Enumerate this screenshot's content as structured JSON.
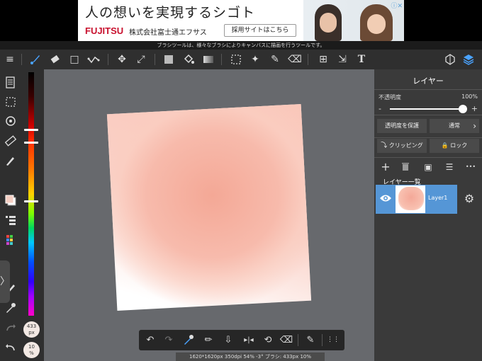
{
  "ad": {
    "headline": "人の想いを実現するシゴト",
    "brand": "FUJITSU",
    "company": "株式会社富士通エフサス",
    "button_label": "採用サイトはこちら",
    "ad_marker": "ⓘ✕"
  },
  "tooltip": "ブラシツールは、様々なブラシによりキャンバスに描画を行うツールです。",
  "toolbar": {
    "menu_icon": "≡",
    "brush_icon": "🖌",
    "eraser_icon": "◆",
    "shape_icon": "□",
    "move_icon": "✥",
    "transform_icon": "⤢",
    "fill_color_icon": "■",
    "bucket_icon": "◈",
    "gradient_icon": "▭",
    "select_icon": "⬚",
    "magic_wand_icon": "✦",
    "select_pen_icon": "✎",
    "select_eraser_icon": "⌫",
    "frame_icon": "⊞",
    "operation_icon": "⇲",
    "text_icon": "T",
    "material_icon": "⬡",
    "layers_icon": "◈"
  },
  "left_panel": {
    "brush_size_label": "433",
    "brush_size_unit": "px",
    "opacity_label": "10",
    "opacity_unit": "%",
    "collapse_icon": "〉"
  },
  "colors": {
    "primary": "#f5cfc3",
    "accent": "#5596d6",
    "paint": "#f4a898"
  },
  "bottom_bar": {
    "undo_icon": "↶",
    "redo_icon": "↷",
    "eyedropper_icon": "⚲",
    "pen_icon": "✏",
    "save_icon": "⇩",
    "flip_icon": "▸|◂",
    "rotate_icon": "⟲",
    "clear_icon": "⌫",
    "edit_icon": "✎",
    "grip_icon": "⋮⋮"
  },
  "status": "1620*1620px 350dpi 54% -3° ブラシ: 433px 10%",
  "right_panel": {
    "title": "レイヤー",
    "opacity_label": "不透明度",
    "opacity_value": "100%",
    "opacity_level": 0.95,
    "minus": "-",
    "plus": "+",
    "protect_alpha_label": "透明度を保護",
    "blend_mode_label": "通常",
    "blend_chevron": "›",
    "clipping_label": "クリッピング",
    "lock_label": "ロック",
    "add_icon": "+",
    "trash_icon": "🗑",
    "image_icon": "▣",
    "list_icon": "☰",
    "more_icon": "•••",
    "layer_list_label": "レイヤー一覧",
    "layers": [
      {
        "name": "Layer1",
        "visible": true
      }
    ],
    "eye_icon": "◉",
    "gear_icon": "⚙"
  }
}
